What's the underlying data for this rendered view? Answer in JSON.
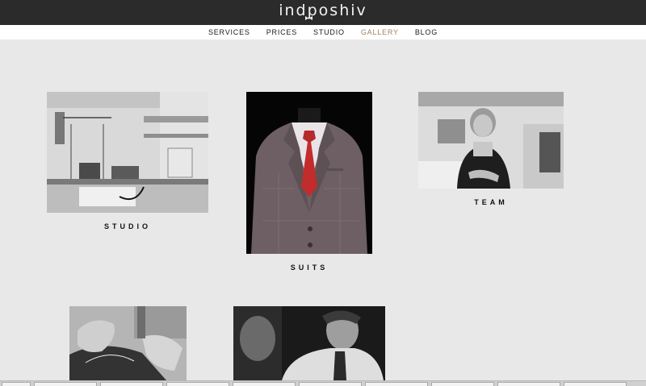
{
  "brand": {
    "logo_text": "indposhiv"
  },
  "nav": {
    "items": [
      {
        "label": "SERVICES"
      },
      {
        "label": "PRICES"
      },
      {
        "label": "STUDIO"
      },
      {
        "label": "GALLERY",
        "active": true
      },
      {
        "label": "BLOG"
      }
    ]
  },
  "gallery": {
    "tiles": [
      {
        "caption": "STUDIO"
      },
      {
        "caption": "SUITS"
      },
      {
        "caption": "TEAM"
      },
      {
        "caption": ""
      },
      {
        "caption": ""
      }
    ]
  },
  "colors": {
    "header_bg": "#2b2b2b",
    "page_bg": "#e8e8e8",
    "active_nav": "#a08060"
  }
}
